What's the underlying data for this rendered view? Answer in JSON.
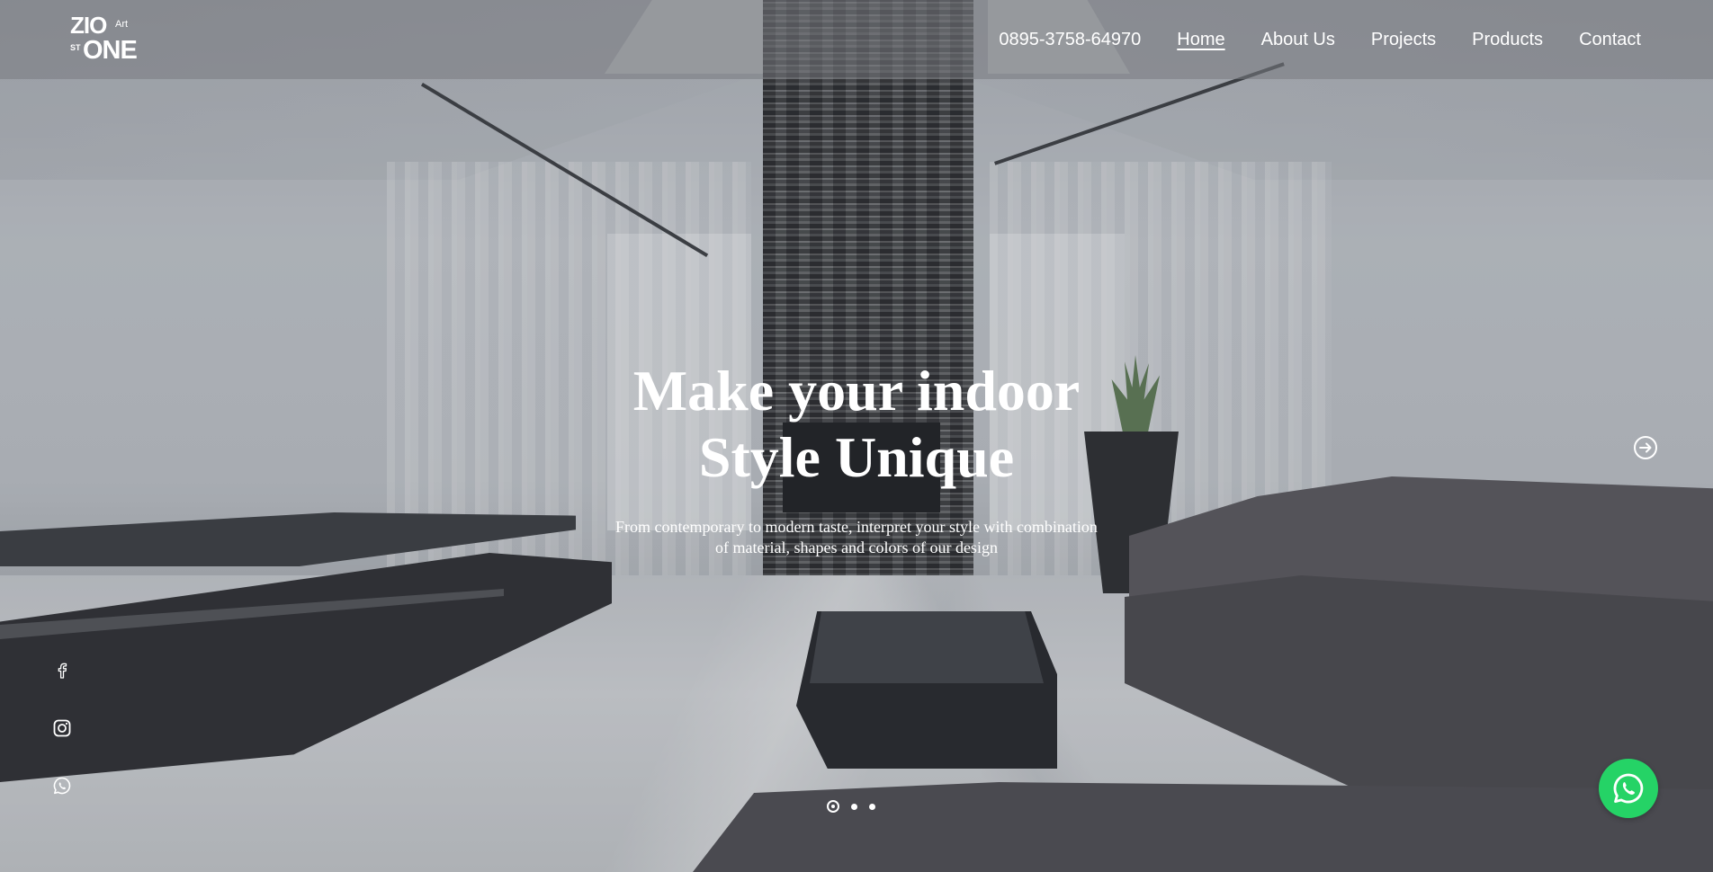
{
  "brand": {
    "logo_top": "ZIO",
    "logo_art": "Art",
    "logo_st": "ST",
    "logo_bottom": "ONE"
  },
  "nav": {
    "phone": "0895-3758-64970",
    "items": [
      {
        "label": "Home",
        "active": true
      },
      {
        "label": "About Us",
        "active": false
      },
      {
        "label": "Projects",
        "active": false
      },
      {
        "label": "Products",
        "active": false
      },
      {
        "label": "Contact",
        "active": false
      }
    ]
  },
  "hero": {
    "title_line1": "Make your indoor",
    "title_line2": "Style Unique",
    "subtitle_line1": "From contemporary to modern taste, interpret your style with combination",
    "subtitle_line2": "of material, shapes and colors of our design"
  },
  "slider": {
    "slide_count": 3,
    "active_index": 0,
    "next_icon": "arrow-right-circle-icon"
  },
  "social": [
    "facebook-icon",
    "instagram-icon",
    "whatsapp-icon"
  ],
  "floating_chat": {
    "icon": "whatsapp-icon",
    "color": "#25d366"
  },
  "colors": {
    "header_overlay": "#787a80",
    "text": "#ffffff",
    "whatsapp": "#25d366"
  }
}
